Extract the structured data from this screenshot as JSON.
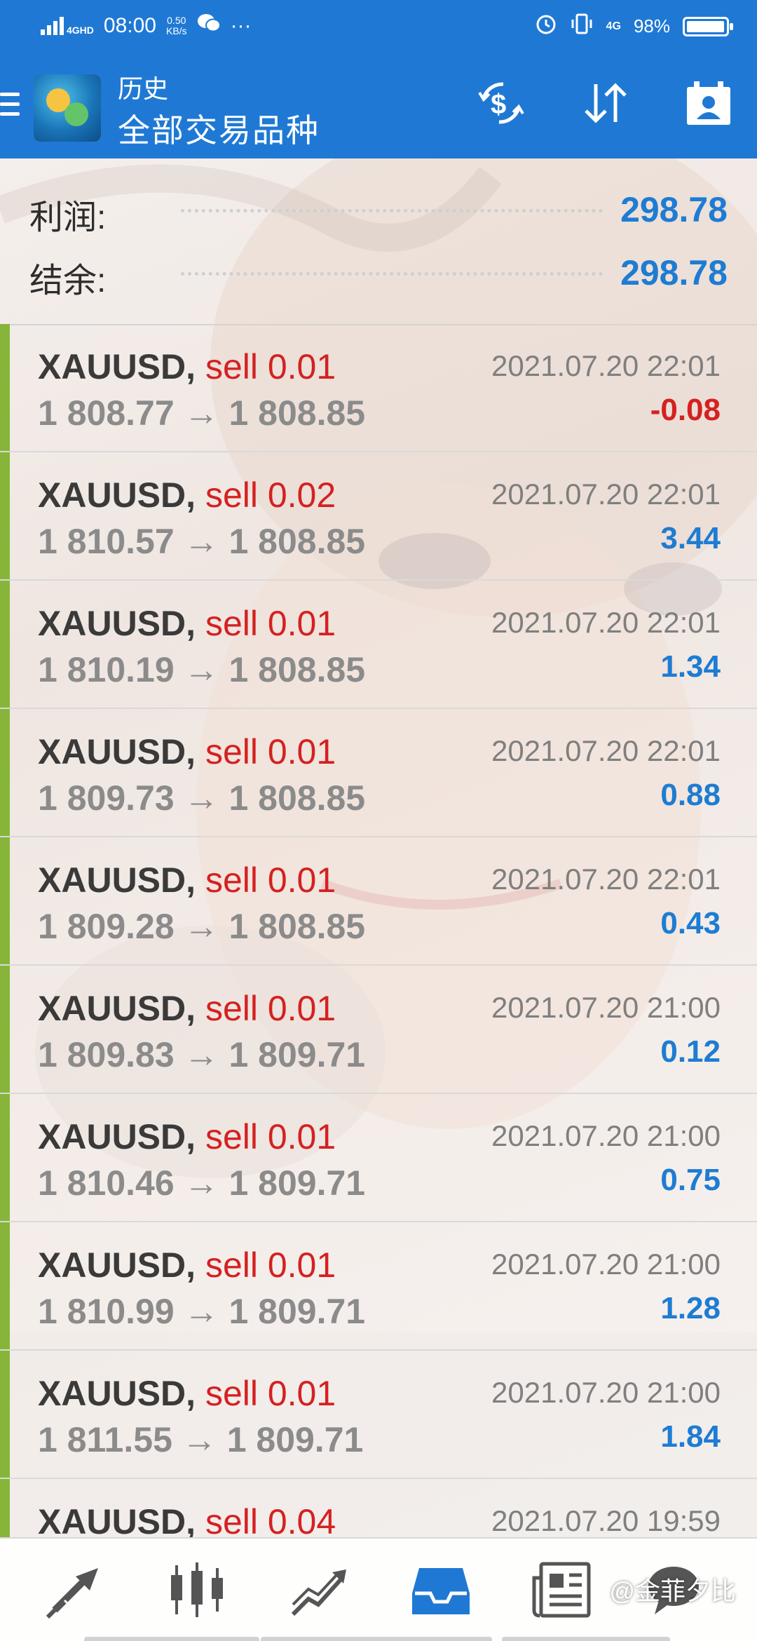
{
  "status_bar": {
    "network": "4GHD",
    "time": "08:00",
    "speed_value": "0.50",
    "speed_unit": "KB/s",
    "extra": "···",
    "battery": "98%",
    "network_right": "4G"
  },
  "app_bar": {
    "title": "历史",
    "subtitle": "全部交易品种",
    "icons": [
      "currency-exchange-icon",
      "sort-icon",
      "calendar-contact-icon"
    ]
  },
  "summary": {
    "profit_label": "利润:",
    "profit_value": "298.78",
    "balance_label": "结余:",
    "balance_value": "298.78"
  },
  "trades": [
    {
      "symbol": "XAUUSD,",
      "type": "sell 0.01",
      "open": "1 808.77",
      "arrow": "→",
      "close": "1 808.85",
      "time": "2021.07.20 22:01",
      "profit": "-0.08",
      "negative": true
    },
    {
      "symbol": "XAUUSD,",
      "type": "sell 0.02",
      "open": "1 810.57",
      "arrow": "→",
      "close": "1 808.85",
      "time": "2021.07.20 22:01",
      "profit": "3.44",
      "negative": false
    },
    {
      "symbol": "XAUUSD,",
      "type": "sell 0.01",
      "open": "1 810.19",
      "arrow": "→",
      "close": "1 808.85",
      "time": "2021.07.20 22:01",
      "profit": "1.34",
      "negative": false
    },
    {
      "symbol": "XAUUSD,",
      "type": "sell 0.01",
      "open": "1 809.73",
      "arrow": "→",
      "close": "1 808.85",
      "time": "2021.07.20 22:01",
      "profit": "0.88",
      "negative": false
    },
    {
      "symbol": "XAUUSD,",
      "type": "sell 0.01",
      "open": "1 809.28",
      "arrow": "→",
      "close": "1 808.85",
      "time": "2021.07.20 22:01",
      "profit": "0.43",
      "negative": false
    },
    {
      "symbol": "XAUUSD,",
      "type": "sell 0.01",
      "open": "1 809.83",
      "arrow": "→",
      "close": "1 809.71",
      "time": "2021.07.20 21:00",
      "profit": "0.12",
      "negative": false
    },
    {
      "symbol": "XAUUSD,",
      "type": "sell 0.01",
      "open": "1 810.46",
      "arrow": "→",
      "close": "1 809.71",
      "time": "2021.07.20 21:00",
      "profit": "0.75",
      "negative": false
    },
    {
      "symbol": "XAUUSD,",
      "type": "sell 0.01",
      "open": "1 810.99",
      "arrow": "→",
      "close": "1 809.71",
      "time": "2021.07.20 21:00",
      "profit": "1.28",
      "negative": false
    },
    {
      "symbol": "XAUUSD,",
      "type": "sell 0.01",
      "open": "1 811.55",
      "arrow": "→",
      "close": "1 809.71",
      "time": "2021.07.20 21:00",
      "profit": "1.84",
      "negative": false
    },
    {
      "symbol": "XAUUSD,",
      "type": "sell 0.04",
      "open": "",
      "arrow": "",
      "close": "",
      "time": "2021.07.20 19:59",
      "profit": "",
      "negative": false
    }
  ],
  "bottom_nav": {
    "items": [
      "trade-arrows-icon",
      "candlestick-icon",
      "chart-trend-icon",
      "history-inbox-icon",
      "news-icon",
      "chat-icon"
    ],
    "active": "history-inbox-icon",
    "watermark": "@金菲夕比"
  },
  "colors": {
    "accent": "#1f79d4",
    "profit_positive": "#1e7cd2",
    "profit_negative": "#d42121",
    "sell": "#d42121",
    "row_bar": "#86b53a",
    "active_nav": "#1f79d4"
  }
}
